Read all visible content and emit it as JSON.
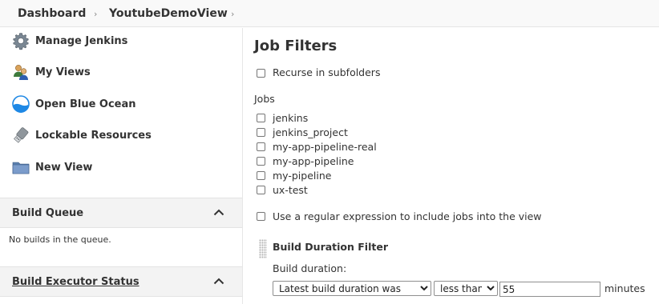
{
  "breadcrumb": {
    "items": [
      "Dashboard",
      "YoutubeDemoView"
    ]
  },
  "sidebar": {
    "items": [
      {
        "label": "Manage Jenkins",
        "icon": "gear-icon"
      },
      {
        "label": "My Views",
        "icon": "people-icon"
      },
      {
        "label": "Open Blue Ocean",
        "icon": "blue-ocean-icon"
      },
      {
        "label": "Lockable Resources",
        "icon": "usb-key-icon"
      },
      {
        "label": "New View",
        "icon": "folder-icon"
      }
    ],
    "build_queue": {
      "title": "Build Queue",
      "empty_text": "No builds in the queue."
    },
    "executor_status": {
      "title": "Build Executor Status"
    }
  },
  "main": {
    "title": "Job Filters",
    "recurse_label": "Recurse in subfolders",
    "jobs_heading": "Jobs",
    "jobs": [
      {
        "name": "jenkins",
        "checked": false
      },
      {
        "name": "jenkins_project",
        "checked": false
      },
      {
        "name": "my-app-pipeline-real",
        "checked": false
      },
      {
        "name": "my-app-pipeline",
        "checked": false
      },
      {
        "name": "my-pipeline",
        "checked": false
      },
      {
        "name": "ux-test",
        "checked": false
      }
    ],
    "regex_label": "Use a regular expression to include jobs into the view",
    "duration_filter": {
      "title": "Build Duration Filter",
      "field_label": "Build duration:",
      "mode_value": "Latest build duration was",
      "comparator_value": "less than",
      "amount_value": "55",
      "unit_label": "minutes"
    }
  },
  "colors": {
    "accent": "#335c99",
    "pane_header_bg": "#f3f3f3"
  }
}
